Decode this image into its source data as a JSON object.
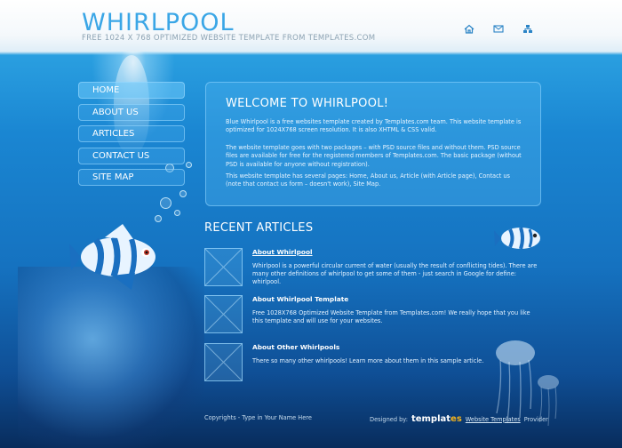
{
  "header": {
    "logo": "WHIRLPOOL",
    "tagline": "FREE 1024 X 768 OPTIMIZED WEBSITE TEMPLATE FROM TEMPLATES.COM",
    "icons": [
      "home-icon",
      "mail-icon",
      "sitemap-icon"
    ]
  },
  "nav": {
    "items": [
      {
        "label": "HOME"
      },
      {
        "label": "ABOUT US"
      },
      {
        "label": "ARTICLES"
      },
      {
        "label": "CONTACT US"
      },
      {
        "label": "SITE MAP"
      }
    ]
  },
  "welcome": {
    "title": "WELCOME TO WHIRLPOOL!",
    "p1": "Blue Whirlpool is a free websites template created by Templates.com team. This website template is optimized for 1024X768 screen resolution. It is also XHTML & CSS valid.",
    "p2": "The website template goes with two packages – with PSD source files and without them. PSD source files are available for free for the registered members of Templates.com. The basic package (without PSD is available for anyone without registration).",
    "p3": "This website template has several pages: Home, About us, Article (with Article page), Contact us (note that contact us form – doesn't work), Site Map."
  },
  "recent": {
    "title": "RECENT ARTICLES",
    "articles": [
      {
        "title": "About Whirlpool",
        "desc": "Whirlpool is a powerful circular current of water (usually the result of conflicting tides). There are many other definitions of whirlpool to get some of them - just search in Google for define: whirlpool."
      },
      {
        "title": "About Whirlpool Template",
        "desc": "Free 1028X768 Optimized Website Template from Templates.com! We really hope that you like this template and will use for your websites."
      },
      {
        "title": "About Other Whirlpools",
        "desc": "There so many other whirlpools! Learn more about them in this sample article."
      }
    ]
  },
  "footer": {
    "copyright": "Copyrights - Type in Your Name Here",
    "designed_by": "Designed by:",
    "brand_main": "templat",
    "brand_accent": "es",
    "link": "Website Templates",
    "provider": "Provider"
  },
  "colors": {
    "logo": "#3aa6e6",
    "accent": "#f2b21c"
  }
}
